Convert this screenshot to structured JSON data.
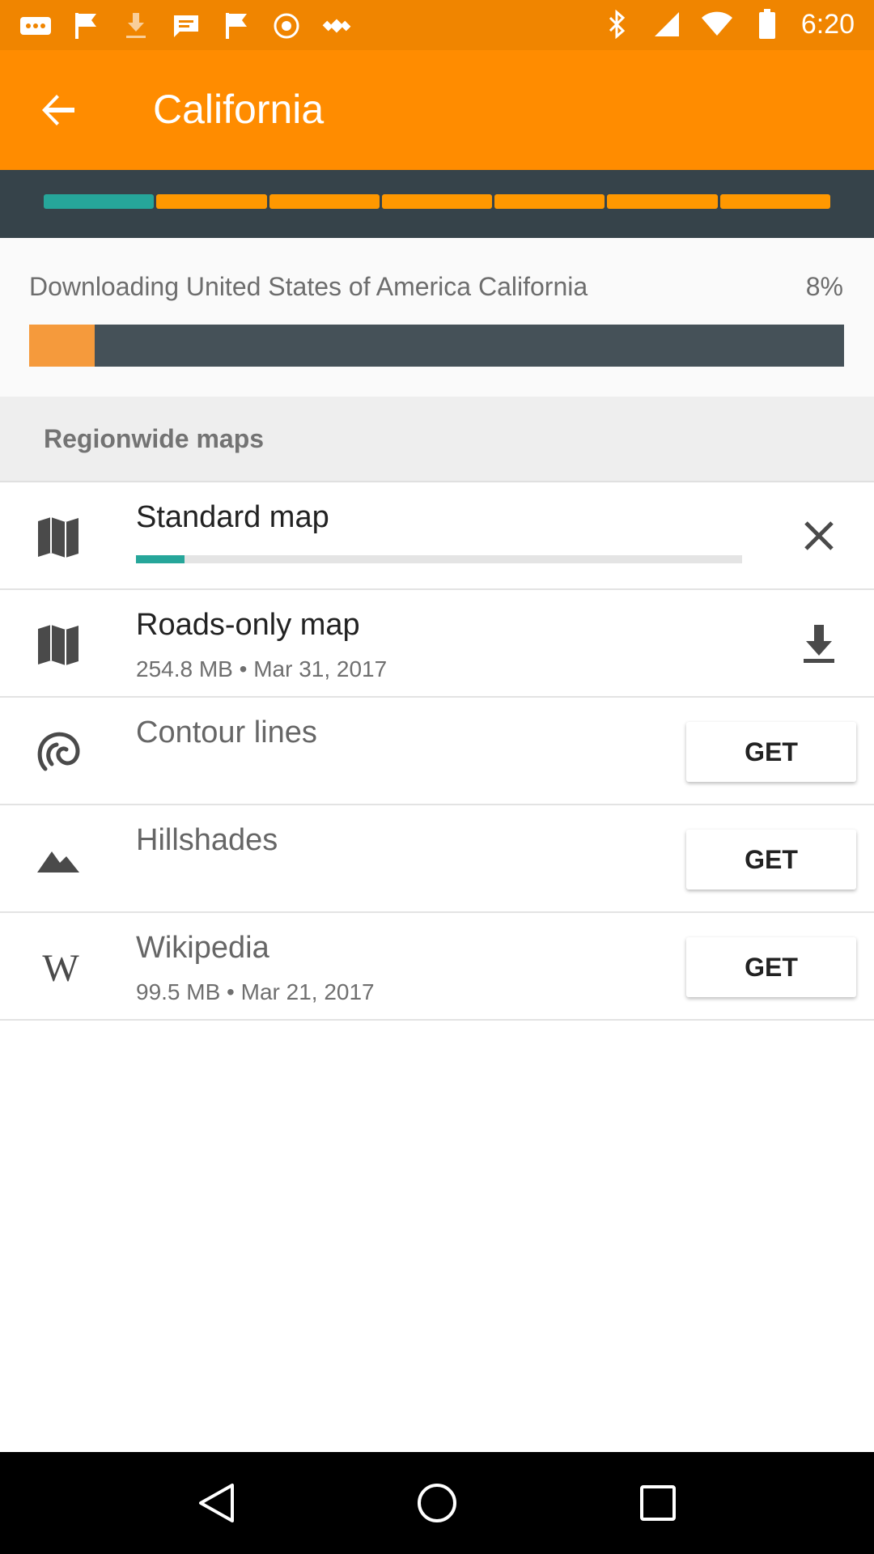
{
  "status_bar": {
    "time": "6:20",
    "left_icons": [
      "more-icon",
      "flag-icon",
      "download-icon",
      "message-icon",
      "flag-icon",
      "settings-icon",
      "satellite-icon"
    ],
    "right_icons": [
      "bluetooth-icon",
      "signal-icon",
      "wifi-icon",
      "battery-icon"
    ]
  },
  "app_bar": {
    "title": "California",
    "back_icon": "arrow-back-icon"
  },
  "tab_strip": {
    "segments": 7,
    "active_index": 0,
    "colors": {
      "active": "#26a69a",
      "inactive": "#ff9800"
    }
  },
  "download": {
    "text": "Downloading United States of America California",
    "percent_label": "8%",
    "progress": 0.08
  },
  "section": {
    "title": "Regionwide maps"
  },
  "rows": [
    {
      "title": "Standard map",
      "subtitle": "",
      "icon": "map-icon",
      "action": "close-icon",
      "progress": 0.08
    },
    {
      "title": "Roads-only map",
      "subtitle": "254.8 MB • Mar 31, 2017",
      "icon": "map-icon",
      "action": "download-icon"
    },
    {
      "title": "Contour lines",
      "subtitle": "",
      "icon": "contour-icon",
      "action_label": "GET"
    },
    {
      "title": "Hillshades",
      "subtitle": "",
      "icon": "mountain-icon",
      "action_label": "GET"
    },
    {
      "title": "Wikipedia",
      "subtitle": "99.5 MB • Mar 21, 2017",
      "icon": "wikipedia-icon",
      "action_label": "GET",
      "icon_text": "W"
    }
  ],
  "colors": {
    "accent": "#ff8c00",
    "status": "#f08500",
    "dark": "#36434a",
    "teal": "#26a69a"
  },
  "nav_bar": {
    "icons": [
      "back-triangle-icon",
      "home-circle-icon",
      "recents-square-icon"
    ]
  }
}
